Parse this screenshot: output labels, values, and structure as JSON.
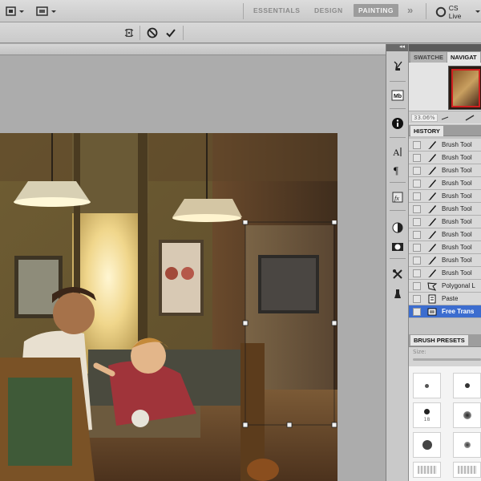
{
  "appbar": {
    "workspaces": [
      "ESSENTIALS",
      "DESIGN",
      "PAINTING"
    ],
    "active_workspace": "PAINTING",
    "more_glyph": "»",
    "cslive": "CS Live"
  },
  "options": {
    "icons": [
      "warp-icon",
      "cancel-transform-icon",
      "commit-transform-icon"
    ]
  },
  "panels": {
    "collapse_glyph": "◂◂",
    "top_tabs": [
      "SWATCHE",
      "NAVIGAT"
    ],
    "zoom_value": "33.06%",
    "history_tab": "HISTORY",
    "history_items": [
      {
        "label": "Brush Tool",
        "icon": "brush-icon"
      },
      {
        "label": "Brush Tool",
        "icon": "brush-icon"
      },
      {
        "label": "Brush Tool",
        "icon": "brush-icon"
      },
      {
        "label": "Brush Tool",
        "icon": "brush-icon"
      },
      {
        "label": "Brush Tool",
        "icon": "brush-icon"
      },
      {
        "label": "Brush Tool",
        "icon": "brush-icon"
      },
      {
        "label": "Brush Tool",
        "icon": "brush-icon"
      },
      {
        "label": "Brush Tool",
        "icon": "brush-icon"
      },
      {
        "label": "Brush Tool",
        "icon": "brush-icon"
      },
      {
        "label": "Brush Tool",
        "icon": "brush-icon"
      },
      {
        "label": "Brush Tool",
        "icon": "brush-icon"
      },
      {
        "label": "Polygonal L",
        "icon": "lasso-icon"
      },
      {
        "label": "Paste",
        "icon": "paste-icon"
      },
      {
        "label": "Free Trans",
        "icon": "free-transform-icon"
      }
    ],
    "selected_history": "Free Trans",
    "brush_presets_tab": "BRUSH PRESETS",
    "brush_size_label": "Size:",
    "brush_preset_number": "18"
  }
}
